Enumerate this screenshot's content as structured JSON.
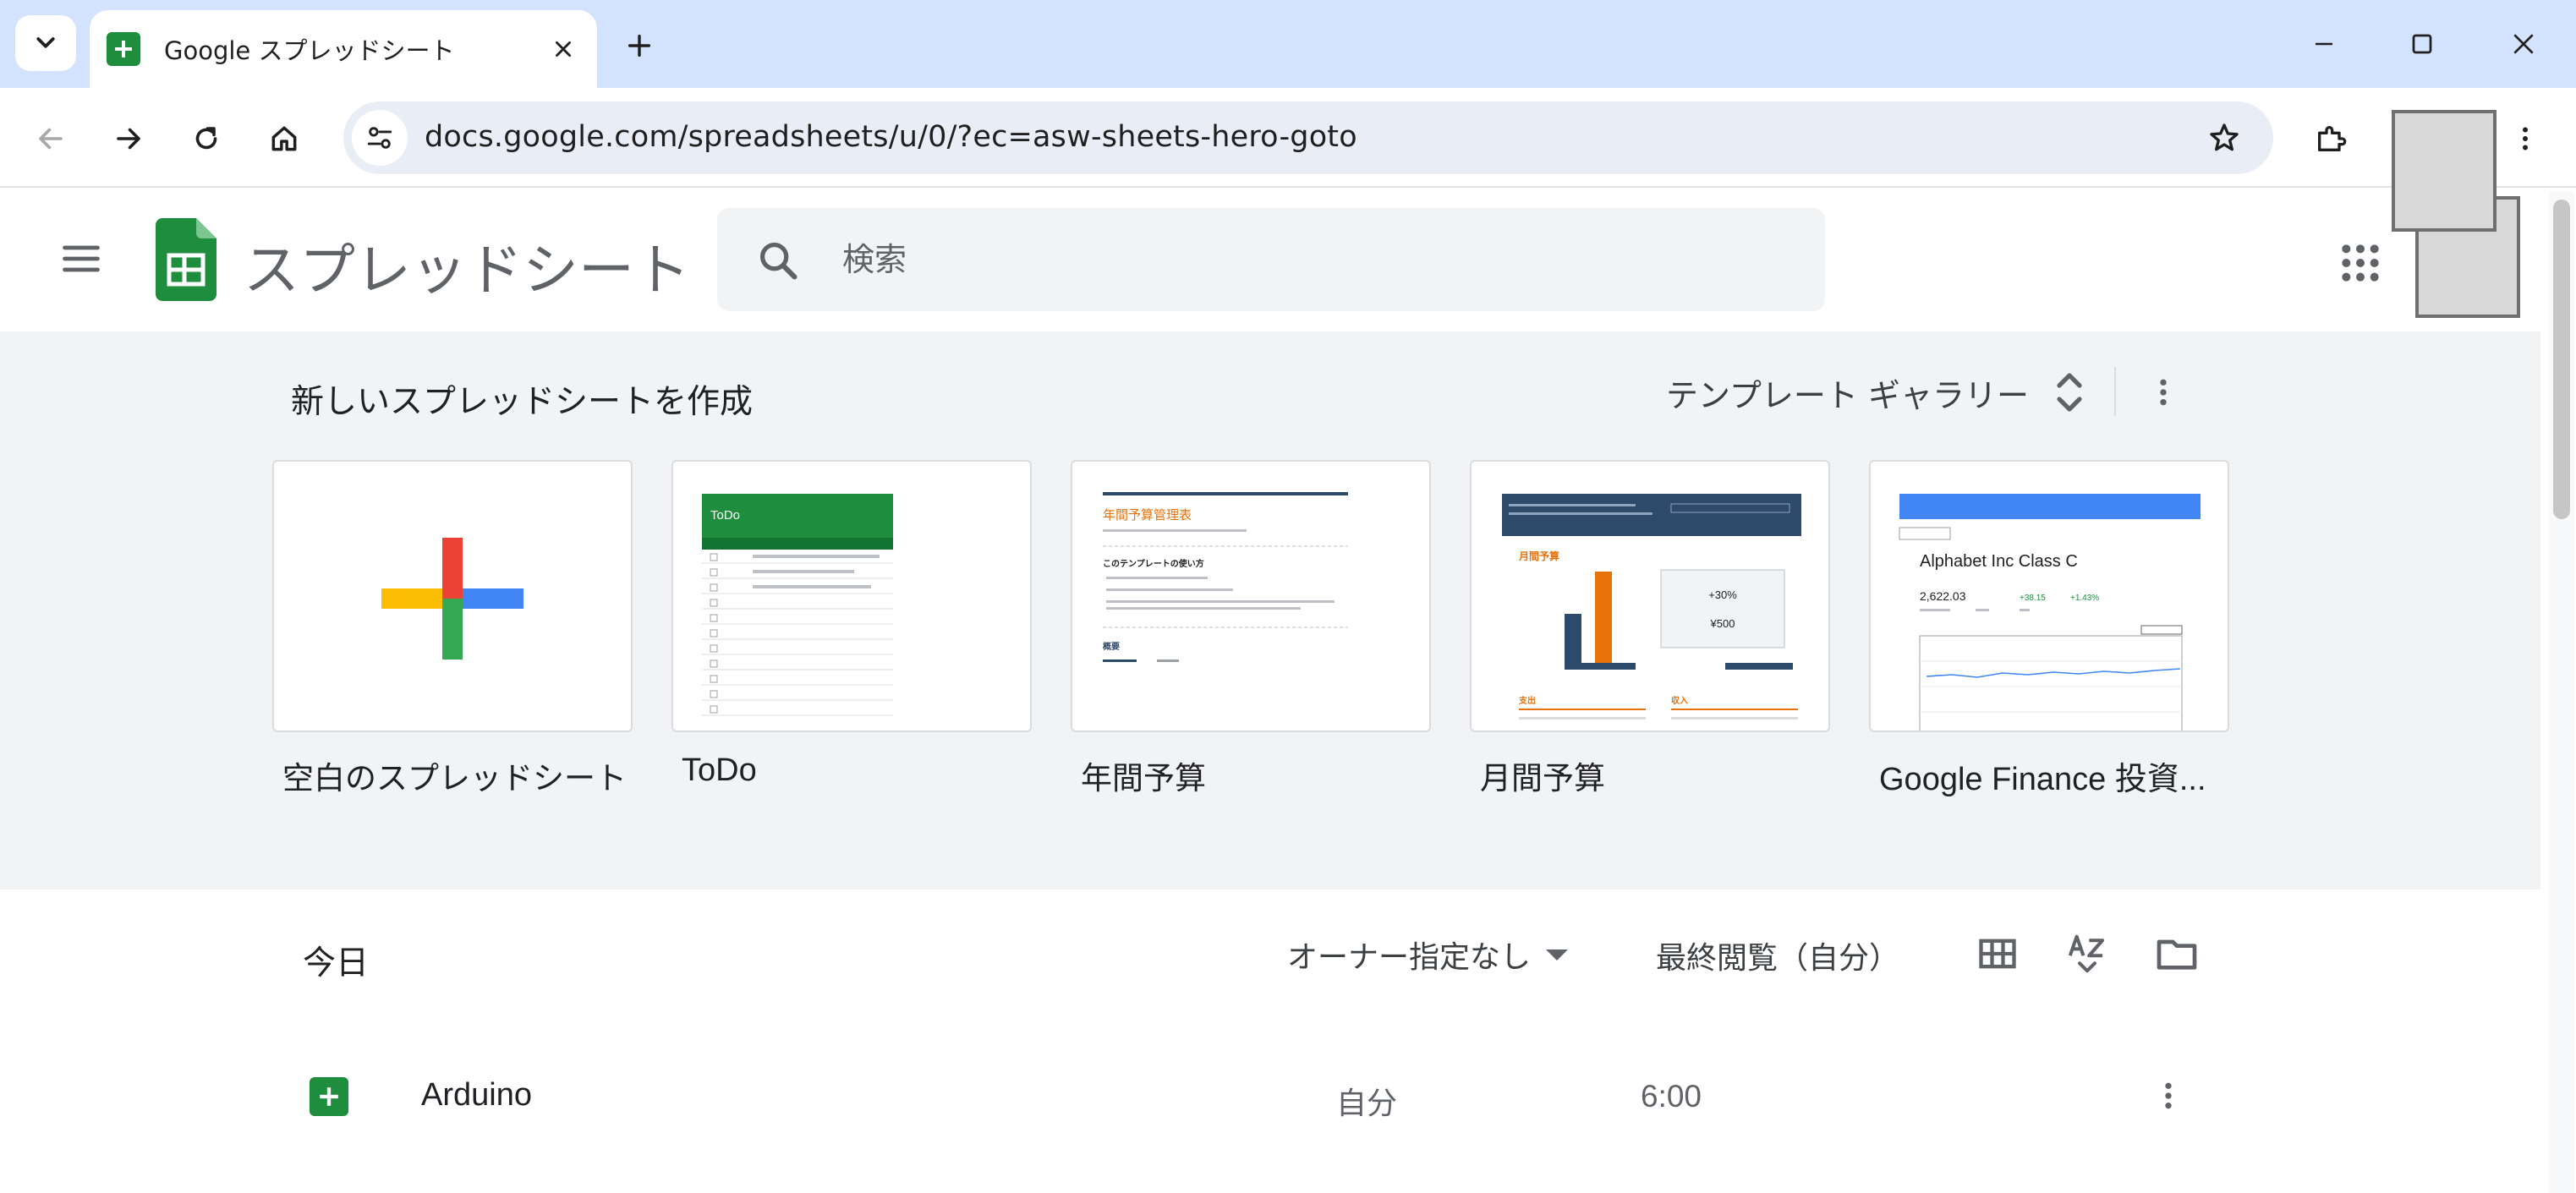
{
  "browser": {
    "tab_title": "Google スプレッドシート",
    "url": "docs.google.com/spreadsheets/u/0/?ec=asw-sheets-hero-goto"
  },
  "app": {
    "title": "スプレッドシート",
    "search_placeholder": "検索"
  },
  "templates": {
    "heading": "新しいスプレッドシートを作成",
    "gallery_label": "テンプレート ギャラリー",
    "items": [
      {
        "label": "空白のスプレッドシート"
      },
      {
        "label": "ToDo"
      },
      {
        "label": "年間予算"
      },
      {
        "label": "月間予算"
      },
      {
        "label": "Google Finance 投資..."
      }
    ],
    "thumb_text": {
      "todo_title": "ToDo",
      "annual_title": "年間予算管理表",
      "annual_howto": "このテンプレートの使い方",
      "annual_summary": "概要",
      "monthly_title": "月間予算",
      "monthly_pct": "+30%",
      "monthly_amount": "¥500",
      "monthly_expense": "支出",
      "monthly_income": "収入",
      "finance_name": "Alphabet Inc Class C",
      "finance_price": "2,622.03",
      "finance_change": "+38.15",
      "finance_pct": "+1.43%"
    }
  },
  "recent": {
    "section_label": "今日",
    "owner_filter": "オーナー指定なし",
    "sort_label": "最終閲覧（自分）",
    "files": [
      {
        "name": "Arduino",
        "owner": "自分",
        "time": "6:00"
      }
    ]
  },
  "colors": {
    "sheets_green": "#1e8e3e",
    "chrome_tabstrip": "#d3e3fd",
    "template_bg": "#f1f3f4"
  }
}
